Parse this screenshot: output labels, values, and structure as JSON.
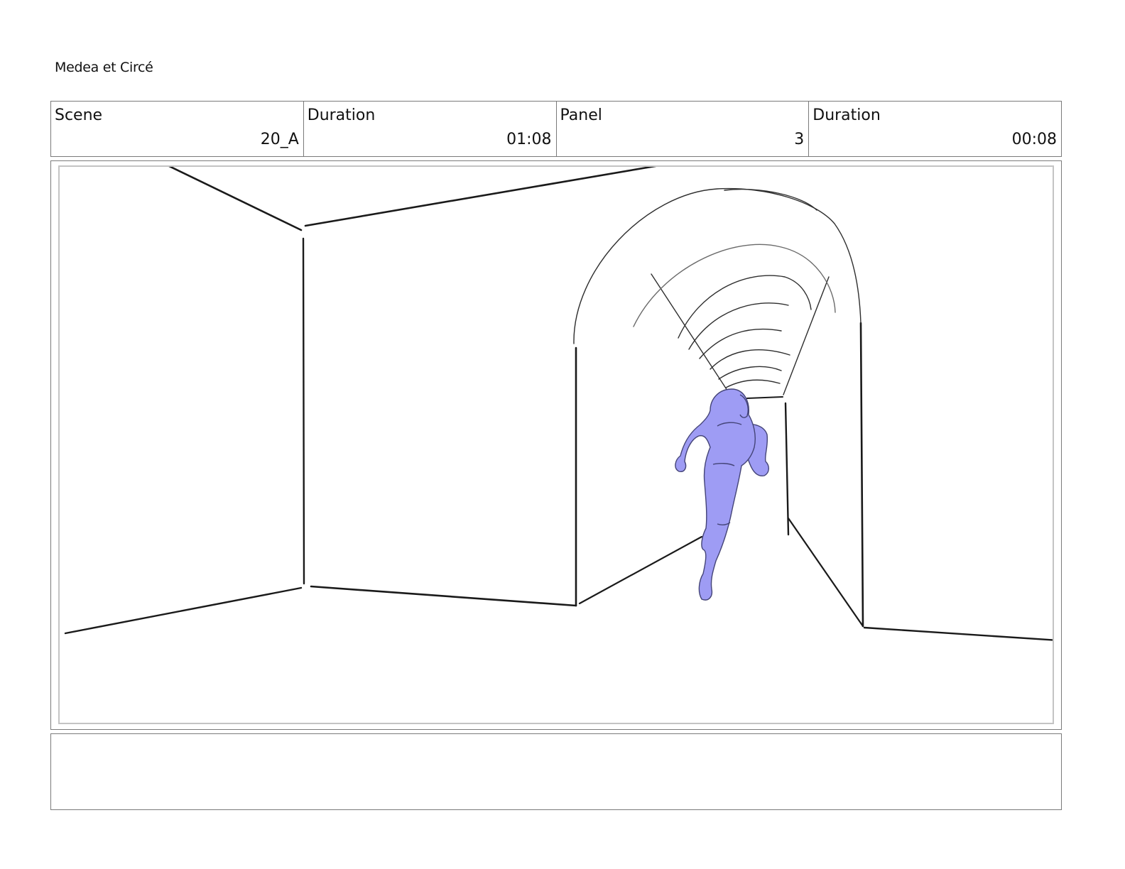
{
  "document": {
    "title": "Medea et Circé"
  },
  "info": [
    {
      "label": "Scene",
      "value": "20_A"
    },
    {
      "label": "Duration",
      "value": "01:08"
    },
    {
      "label": "Panel",
      "value": "3"
    },
    {
      "label": "Duration",
      "value": "00:08"
    }
  ],
  "panel": {
    "sketch": "storyboard-drawing-figure-running-into-tunnel",
    "figure_color": "#9e9cf4"
  },
  "notes": {
    "text": ""
  }
}
